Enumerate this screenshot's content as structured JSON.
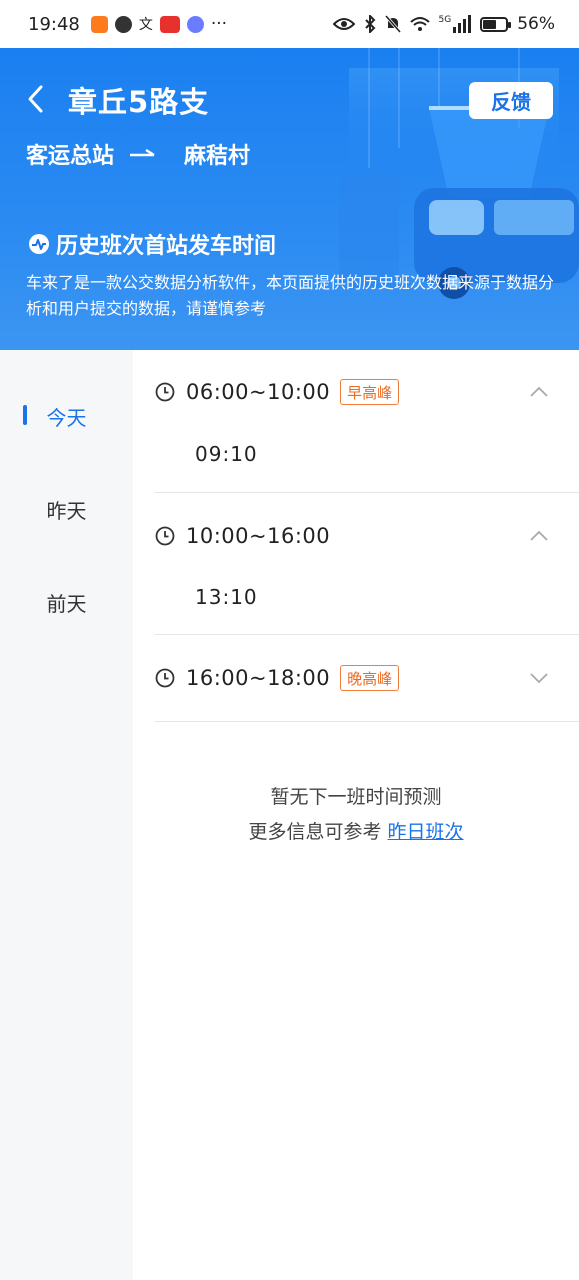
{
  "status_bar": {
    "time": "19:48",
    "more": "···",
    "battery": "56%",
    "battery_level": 0.56,
    "network": "5G"
  },
  "header": {
    "route_name": "章丘5路支",
    "feedback_label": "反馈",
    "from_stop": "客运总站",
    "to_stop": "麻秸村",
    "section_title": "历史班次首站发车时间",
    "description": "车来了是一款公交数据分析软件，本页面提供的历史班次数据来源于数据分析和用户提交的数据，请谨慎参考"
  },
  "sidebar": {
    "items": [
      {
        "label": "今天",
        "active": true
      },
      {
        "label": "昨天",
        "active": false
      },
      {
        "label": "前天",
        "active": false
      }
    ]
  },
  "slots": [
    {
      "range": "06:00~10:00",
      "tag": "早高峰",
      "expanded": true,
      "times": [
        "09:10"
      ]
    },
    {
      "range": "10:00~16:00",
      "tag": "",
      "expanded": true,
      "times": [
        "13:10"
      ]
    },
    {
      "range": "16:00~18:00",
      "tag": "晚高峰",
      "expanded": false,
      "times": []
    }
  ],
  "empty": {
    "line1": "暂无下一班时间预测",
    "line2_prefix": "更多信息可参考",
    "line2_link": "昨日班次"
  },
  "colors": {
    "accent": "#1a73e8",
    "header_bg": "#1f84f1",
    "peak_tag": "#ec6a1f"
  }
}
